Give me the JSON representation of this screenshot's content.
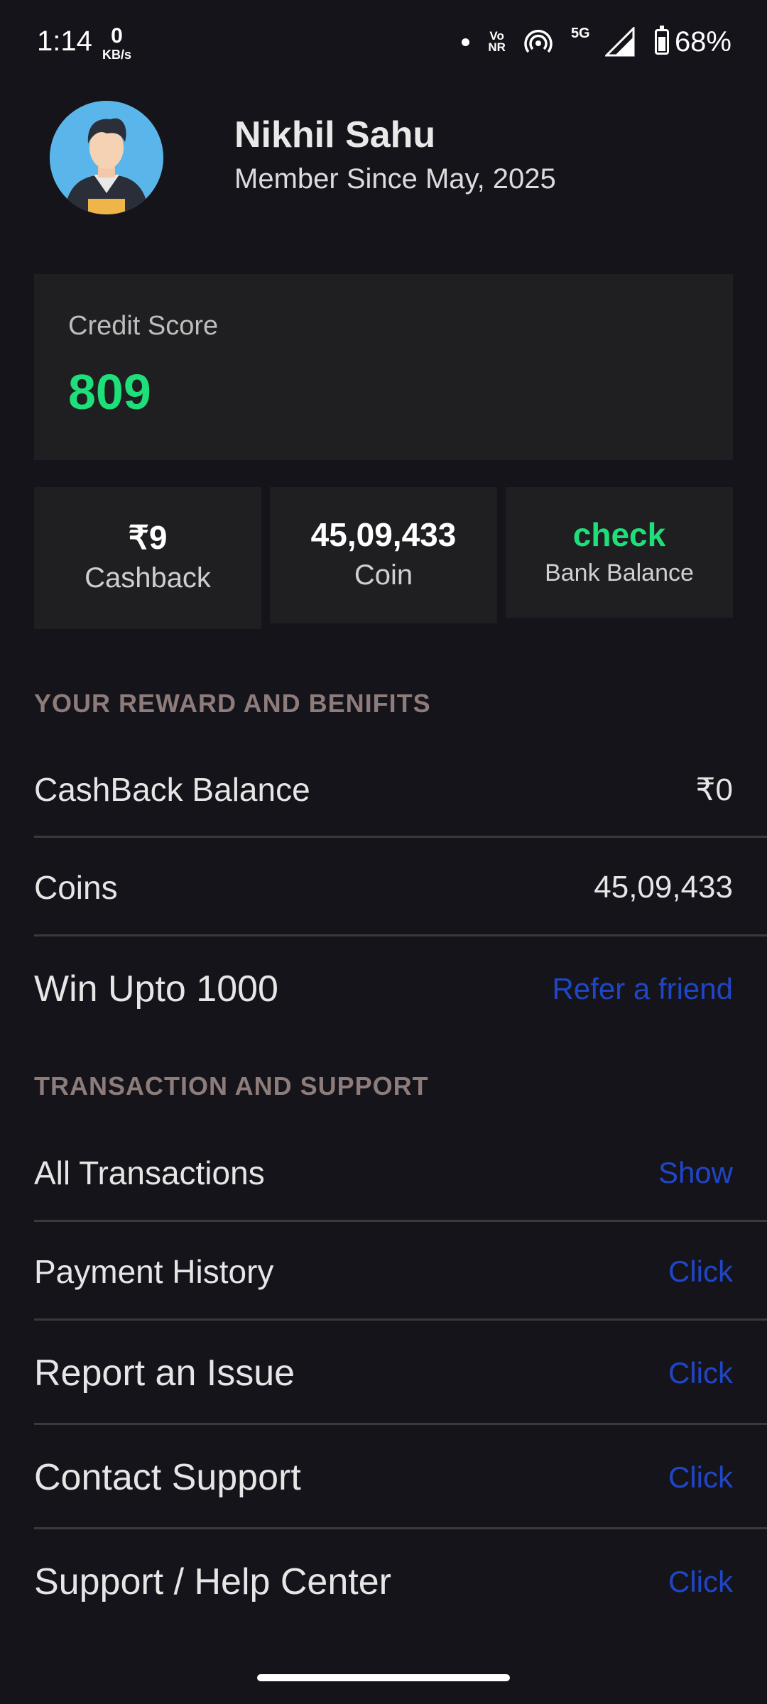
{
  "status_bar": {
    "time": "1:14",
    "speed_value": "0",
    "speed_unit": "KB/s",
    "vonr_top": "Vo",
    "vonr_bottom": "NR",
    "network": "5G",
    "battery": "68%",
    "battery_level": 0.68
  },
  "profile": {
    "name": "Nikhil Sahu",
    "member_since": "Member Since May, 2025"
  },
  "credit": {
    "label": "Credit Score",
    "value": "809"
  },
  "stats": [
    {
      "value": "₹9",
      "label": "Cashback"
    },
    {
      "value": "45,09,433",
      "label": "Coin"
    },
    {
      "value": "check",
      "label": "Bank Balance"
    }
  ],
  "rewards": {
    "title": "YOUR REWARD AND BENIFITS",
    "rows": [
      {
        "label": "CashBack Balance",
        "value": "₹0"
      },
      {
        "label": "Coins",
        "value": "45,09,433"
      },
      {
        "label": "Win Upto 1000",
        "link": "Refer a friend"
      }
    ]
  },
  "support": {
    "title": "TRANSACTION AND SUPPORT",
    "rows": [
      {
        "label": "All Transactions",
        "link": "Show"
      },
      {
        "label": "Payment History",
        "link": "Click"
      },
      {
        "label": "Report an Issue",
        "link": "Click"
      },
      {
        "label": "Contact Support",
        "link": "Click"
      },
      {
        "label": "Support / Help Center",
        "link": "Click"
      }
    ]
  },
  "colors": {
    "background": "#15141a",
    "card": "#1f1f21",
    "accent_green": "#1ee07a",
    "link_blue": "#2046c8",
    "section_title": "#8e7c7a"
  },
  "icons": [
    "wifi-hotspot-icon",
    "signal-icon",
    "battery-icon",
    "avatar"
  ]
}
